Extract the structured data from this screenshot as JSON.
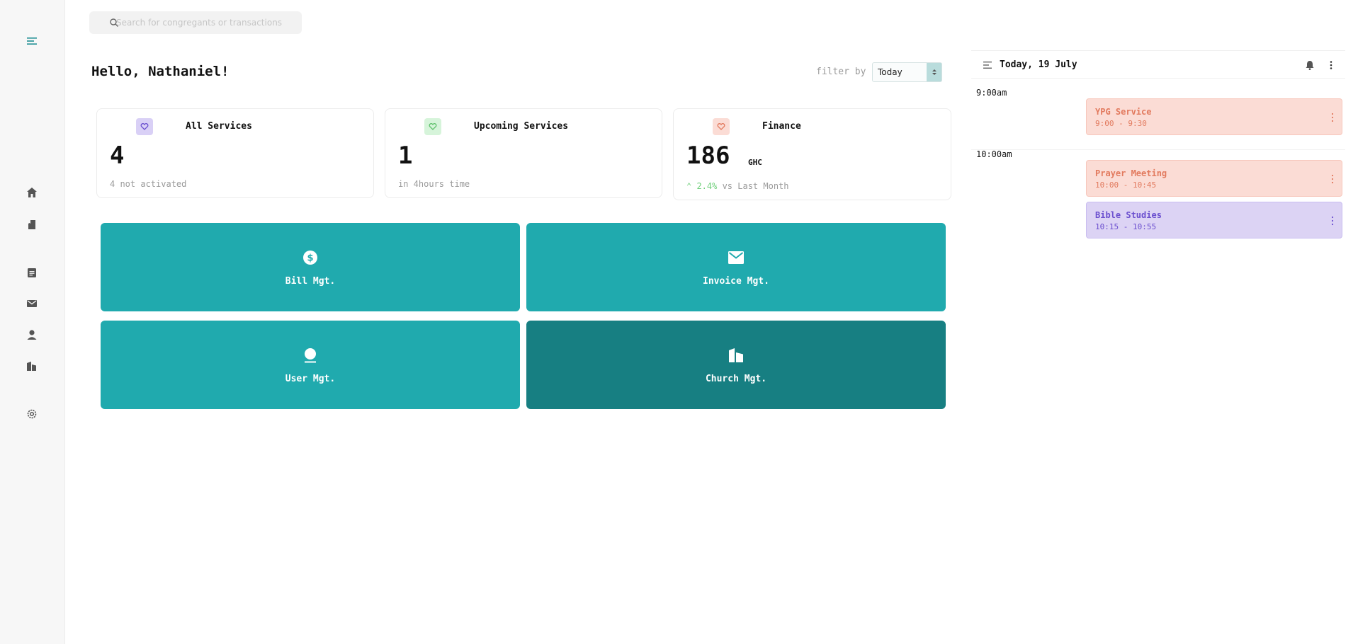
{
  "search": {
    "placeholder": "Search for congregants or transactions"
  },
  "sidebar": {
    "items": [
      {
        "name": "menu-icon"
      },
      {
        "name": "home-icon"
      },
      {
        "name": "book-icon"
      },
      {
        "name": "document-icon"
      },
      {
        "name": "mail-icon"
      },
      {
        "name": "user-icon"
      },
      {
        "name": "building-icon"
      },
      {
        "name": "gear-icon"
      }
    ]
  },
  "greeting": "Hello, Nathaniel!",
  "filter": {
    "label": "filter by",
    "value": "Today"
  },
  "stats": [
    {
      "title": "All Services",
      "value": "4",
      "subtitle": "4 not activated",
      "icon": "heart-icon",
      "color": "#d9d0f6"
    },
    {
      "title": "Upcoming Services",
      "value": "1",
      "subtitle": "in 4hours time",
      "icon": "heart-icon",
      "color": "#d6f4da"
    },
    {
      "title": "Finance",
      "value": "186",
      "unit": "GHC",
      "trend_value": "2.4%",
      "trend_text": " vs Last Month",
      "icon": "heart-icon",
      "color": "#fbdcd5"
    }
  ],
  "tiles": [
    {
      "label": "Bill Mgt.",
      "icon": "dollar-icon"
    },
    {
      "label": "Invoice Mgt.",
      "icon": "mail-icon"
    },
    {
      "label": "User Mgt.",
      "icon": "user-icon"
    },
    {
      "label": "Church Mgt.",
      "icon": "building-icon"
    }
  ],
  "calendar": {
    "date": "Today, 19 July",
    "slots": [
      {
        "time": "9:00am"
      },
      {
        "time": "10:00am"
      }
    ],
    "events": [
      {
        "title": "YPG Service",
        "time": "9:00 - 9:30",
        "color": "#fbdcd5"
      },
      {
        "title": "Prayer Meeting",
        "time": "10:00 - 10:45",
        "color": "#fbdcd5"
      },
      {
        "title": "Bible Studies",
        "time": "10:15 - 10:55",
        "color": "#dcd3f4"
      }
    ]
  }
}
